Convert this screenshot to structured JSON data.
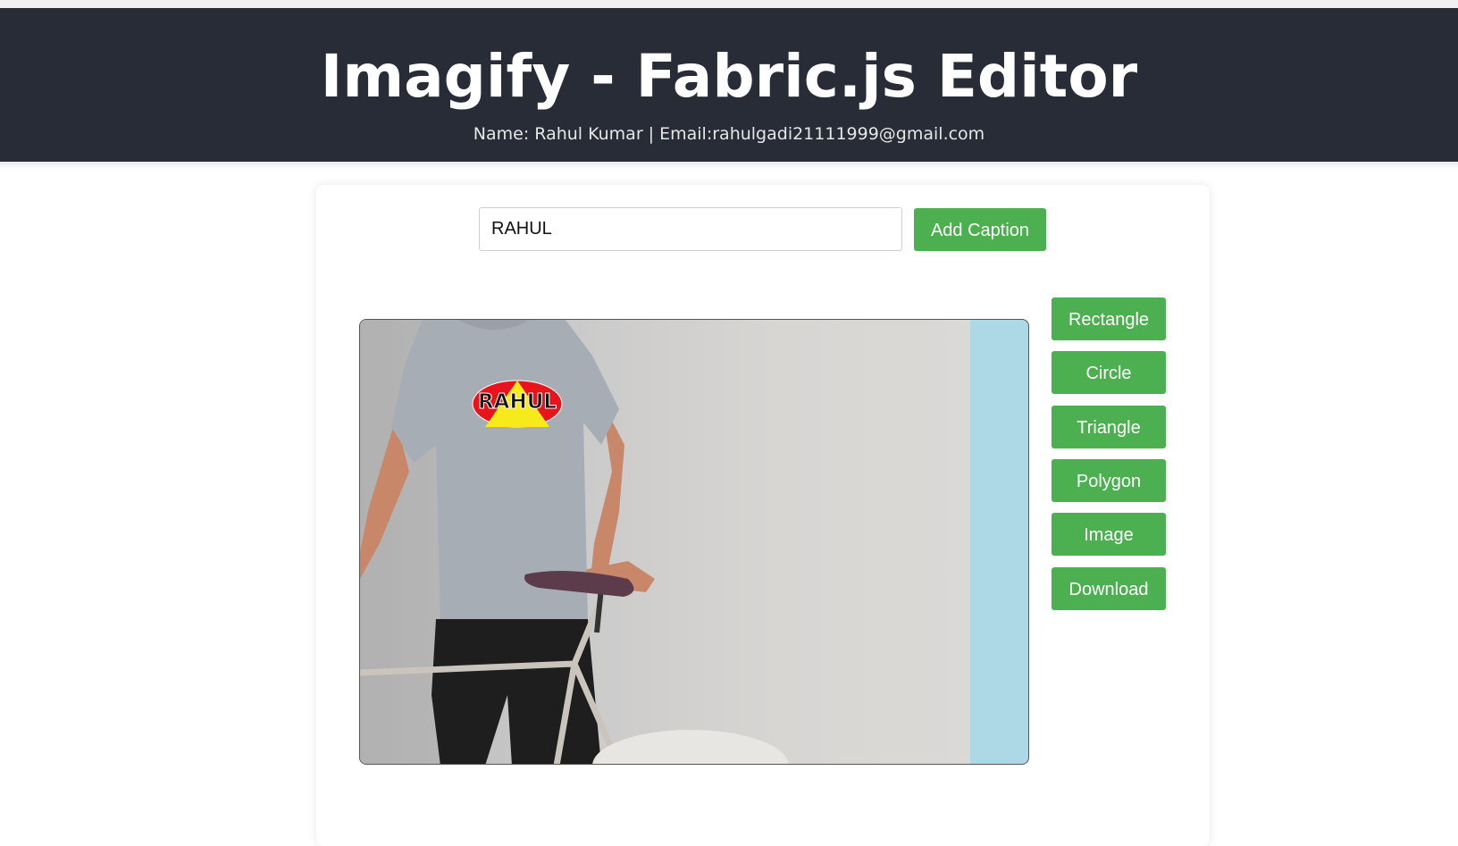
{
  "header": {
    "title": "Imagify - Fabric.js Editor",
    "subtitle": "Name: Rahul Kumar | Email:rahulgadi21111999@gmail.com"
  },
  "caption": {
    "input_value": "RAHUL",
    "add_button_label": "Add Caption"
  },
  "tools": [
    {
      "label": "Rectangle"
    },
    {
      "label": "Circle"
    },
    {
      "label": "Triangle"
    },
    {
      "label": "Polygon"
    },
    {
      "label": "Image"
    },
    {
      "label": "Download"
    }
  ],
  "canvas": {
    "logo_text": "RAHUL",
    "background_color": "#add8e6"
  },
  "colors": {
    "header_bg": "#282c36",
    "button_green": "#4caf50"
  }
}
